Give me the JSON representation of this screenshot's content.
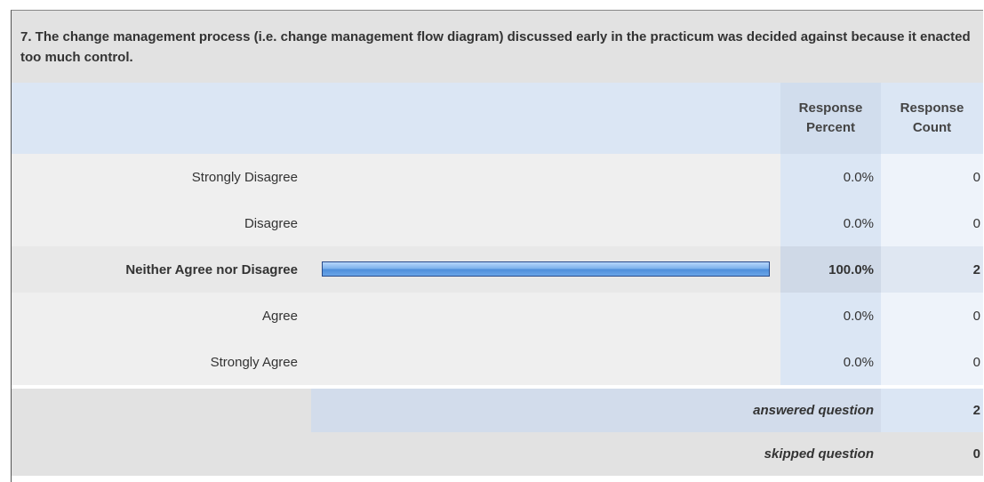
{
  "question": {
    "text": "7. The change management process (i.e. change management flow diagram) discussed early in the practicum was decided against because it enacted too much control."
  },
  "table": {
    "header": {
      "response_percent": "Response Percent",
      "response_count": "Response Count"
    },
    "rows": [
      {
        "label": "Strongly Disagree",
        "percent": "0.0%",
        "count": "0",
        "fraction": 0.0
      },
      {
        "label": "Disagree",
        "percent": "0.0%",
        "count": "0",
        "fraction": 0.0
      },
      {
        "label": "Neither Agree nor Disagree",
        "percent": "100.0%",
        "count": "2",
        "fraction": 1.0
      },
      {
        "label": "Agree",
        "percent": "0.0%",
        "count": "0",
        "fraction": 0.0
      },
      {
        "label": "Strongly Agree",
        "percent": "0.0%",
        "count": "0",
        "fraction": 0.0
      }
    ]
  },
  "summary": {
    "answered_label": "answered question",
    "answered_value": "2",
    "skipped_label": "skipped question",
    "skipped_value": "0"
  },
  "colors": {
    "bar_fill": "#6aa5e8",
    "bar_border": "#274a8a",
    "header_band": "#dbe6f4"
  }
}
